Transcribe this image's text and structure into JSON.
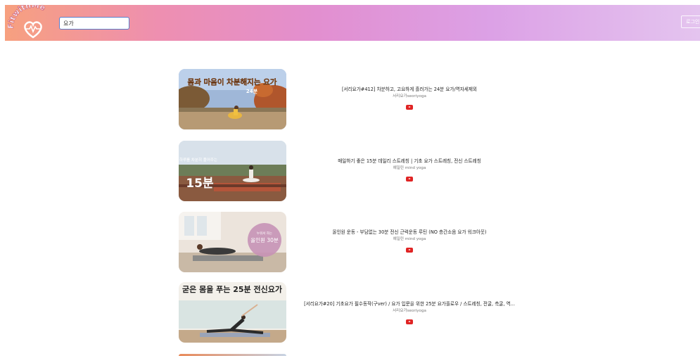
{
  "header": {
    "logo_text": "FitwithMe",
    "search_value": "요가",
    "login_label": "로그인"
  },
  "videos": [
    {
      "thumb_text": "몸과 마음이 차분해지는 요가",
      "thumb_sub": "24분",
      "title": "[서리요가#412] 차분하고, 고요하게 흘러가는 24분 요가/역자세제외",
      "channel": "서리요가seoriyoga",
      "play_icon": "youtube-play-icon"
    },
    {
      "thumb_text": "하루를 차분히 풀어주는",
      "thumb_sub": "15분",
      "title": "매일하기 좋은 15분 데일리 스트레칭 | 기초 요가 스트레칭, 전신 스트레칭",
      "channel": "예일린 mind yoga",
      "play_icon": "youtube-play-icon"
    },
    {
      "thumb_text": "올인원 30분",
      "thumb_sub": "누워서 하는",
      "title": "올인원 운동 - 부담없는 30분 전신 근력운동 루틴 (NO 층간소음 요가 워크아웃)",
      "channel": "예일린 mind yoga",
      "play_icon": "youtube-play-icon"
    },
    {
      "thumb_text": "굳은 몸을 푸는 25분 전신요가",
      "thumb_sub": "",
      "title": "[서리요가#20] 기초요가 필수동작(구ver) / 요가 입문을 위한 25분 요가플로우 / 스트레칭, 전굴, 측굴, 역...",
      "channel": "서리요가seoriyoga",
      "play_icon": "youtube-play-icon"
    }
  ],
  "colors": {
    "accent_red": "#e02424",
    "header_start": "#f7a07f",
    "header_end": "#e4c4ef"
  }
}
